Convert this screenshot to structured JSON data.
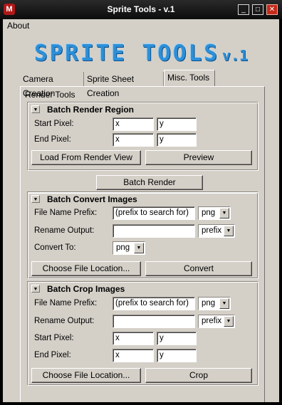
{
  "window": {
    "title": "Sprite Tools - v.1",
    "app_icon": "maya-app-icon",
    "min_glyph": "_",
    "max_glyph": "□",
    "close_glyph": "✕"
  },
  "menu": {
    "about": "About"
  },
  "logo": {
    "main": "SPRITE TOOLS",
    "version": "v.1",
    "color": "#2c8fd8"
  },
  "tabs": [
    "Camera Creation",
    "Sprite Sheet Creation",
    "Misc. Tools"
  ],
  "active_tab": "Misc. Tools",
  "render_tools_label": "Render Tools",
  "collapse_glyph": "▼",
  "batch_render_region": {
    "title": "Batch Render Region",
    "start_pixel_label": "Start Pixel:",
    "start_x": "x",
    "start_y": "y",
    "end_pixel_label": "End Pixel:",
    "end_x": "x",
    "end_y": "y",
    "load_button": "Load From Render View",
    "preview_button": "Preview"
  },
  "batch_render_button": "Batch Render",
  "batch_convert": {
    "title": "Batch Convert Images",
    "prefix_label": "File Name Prefix:",
    "prefix_value": "(prefix to search for)",
    "prefix_format": "png",
    "rename_label": "Rename Output:",
    "rename_value": "",
    "rename_mode": "prefix",
    "convert_to_label": "Convert To:",
    "convert_to_value": "png",
    "choose_button": "Choose File Location...",
    "convert_button": "Convert"
  },
  "batch_crop": {
    "title": "Batch Crop Images",
    "prefix_label": "File Name Prefix:",
    "prefix_value": "(prefix to search for)",
    "prefix_format": "png",
    "rename_label": "Rename Output:",
    "rename_value": "",
    "rename_mode": "prefix",
    "start_pixel_label": "Start Pixel:",
    "start_x": "x",
    "start_y": "y",
    "end_pixel_label": "End Pixel:",
    "end_x": "x",
    "end_y": "y",
    "choose_button": "Choose File Location...",
    "crop_button": "Crop"
  }
}
